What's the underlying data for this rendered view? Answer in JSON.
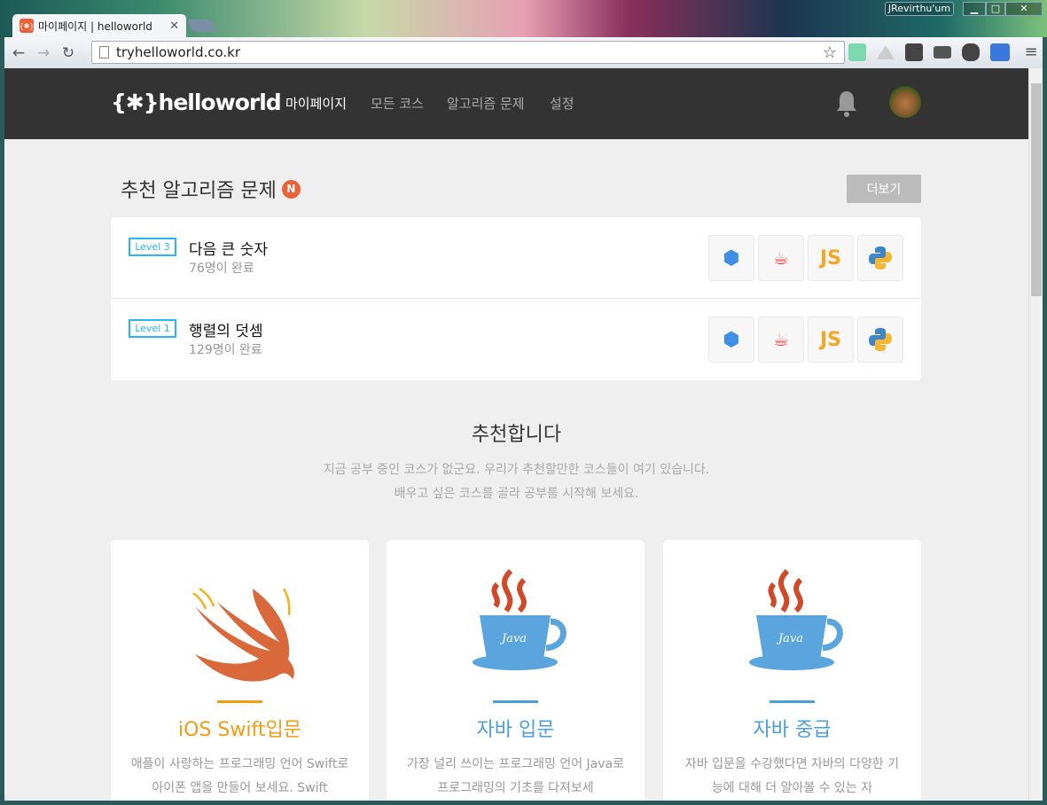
{
  "browser": {
    "tab_title": "마이페이지 | helloworld",
    "tab_favicon": "{✱}",
    "url": "tryhelloworld.co.kr",
    "user": "JRevirthu'um"
  },
  "nav": {
    "logo": "{✱}helloworld",
    "links": [
      "마이페이지",
      "모든 코스",
      "알고리즘 문제",
      "설정"
    ]
  },
  "problems": {
    "title": "추천 알고리즘 문제",
    "new_badge": "N",
    "more": "더보기",
    "items": [
      {
        "level": "Level 3",
        "title": "다음 큰 숫자",
        "done": "76명이 완료"
      },
      {
        "level": "Level 1",
        "title": "행렬의 덧셈",
        "done": "129명이 완료"
      }
    ],
    "languages": [
      "C",
      "Java",
      "JS",
      "Python"
    ]
  },
  "recommend": {
    "title": "추천합니다",
    "sub1": "지금 공부 중인 코스가 없군요. 우리가 추천할만한 코스들이 여기 있습니다.",
    "sub2": "배우고 싶은 코스를 골라 공부를 시작해 보세요.",
    "courses": [
      {
        "title": "iOS Swift입문",
        "desc": "애플이 사랑하는 프로그래밍 언어 Swift로 아이폰 앱을 만들어 보세요. Swift",
        "color": "#f39c12"
      },
      {
        "title": "자바 입문",
        "desc": "가장 널리 쓰이는 프로그래밍 언어 Java로 프로그래밍의 기초를 다져보세",
        "color": "#4a9edb"
      },
      {
        "title": "자바 중급",
        "desc": "자바 입문을 수강했다면 자바의 다양한 기능에 대해 더 알아볼 수 있는 자",
        "color": "#4a9edb"
      }
    ]
  }
}
